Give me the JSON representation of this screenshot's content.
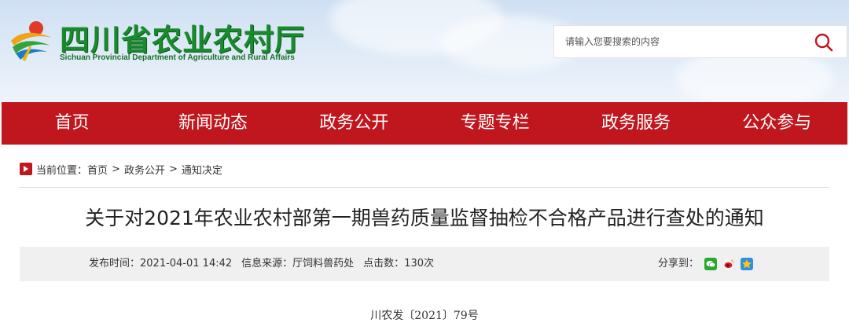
{
  "header": {
    "title": "四川省农业农村厅",
    "subtitle": "Sichuan Provincial Department of Agriculture and Rural Affairs",
    "search": {
      "placeholder": "请输入您要搜索的内容",
      "icon": "search-icon"
    }
  },
  "nav": {
    "items": [
      {
        "label": "首页"
      },
      {
        "label": "新闻动态"
      },
      {
        "label": "政务公开"
      },
      {
        "label": "专题专栏"
      },
      {
        "label": "政务服务"
      },
      {
        "label": "公众参与"
      }
    ]
  },
  "breadcrumb": {
    "prefix": "当前位置：",
    "items": [
      "首页",
      "政务公开",
      "通知决定"
    ],
    "separator": ">"
  },
  "article": {
    "title": "关于对2021年农业农村部第一期兽药质量监督抽检不合格产品进行查处的通知",
    "meta": {
      "publish_time": "发布时间：2021-04-01 14:42",
      "source": "信息来源：厅饲料兽药处",
      "views": "点击数：130次"
    },
    "share_label": "分享到：",
    "share_icons": [
      "wechat-icon",
      "weibo-icon",
      "qzone-icon"
    ],
    "doc_number": "川农发〔2021〕79号"
  },
  "colors": {
    "nav_bg": "#c0161d",
    "title_green": "#1a8a2e"
  }
}
